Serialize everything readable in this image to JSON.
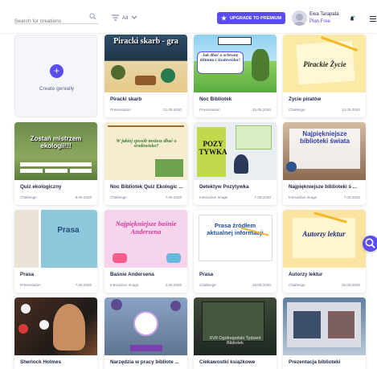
{
  "header": {
    "search_placeholder": "Search for creations",
    "filter_label": "All",
    "upgrade_label": "UPGRADE TO PREMIUM",
    "user_name": "Ewa Tarapata",
    "plan": "Plan Free"
  },
  "create": {
    "label": "Create genially"
  },
  "cards": [
    {
      "title": "Piracki skarb",
      "type": "Presentation",
      "date": "21.09.2020",
      "thumb_text": "Piracki skarb - gra"
    },
    {
      "title": "Noc Bibliotek",
      "type": "Presentation",
      "date": "15.09.2020",
      "thumb_text": "Jak dbać o ochronę klimatu i środowiska?"
    },
    {
      "title": "Życie piratów",
      "type": "Challenge",
      "date": "14.09.2020",
      "thumb_text": "Pirackie Życie"
    },
    {
      "title": "Quiz ekologiczny",
      "type": "Challenge",
      "date": "8.09.2020",
      "thumb_text": "Zostań mistrzem ekologii!!!"
    },
    {
      "title": "Noc Bibliotek Quiz Ekologic ...",
      "type": "Challenge",
      "date": "7.09.2020",
      "thumb_text": "W jakiej sposób możesz dbać o środowisko?"
    },
    {
      "title": "Detektyw Pozytywka",
      "type": "Interactive Image",
      "date": "7.09.2020",
      "thumb_text": "POZY TYWKA"
    },
    {
      "title": "Najpiękniejsze biblioteki ś ...",
      "type": "Interactive Image",
      "date": "7.09.2020",
      "thumb_text": "Najpiękniejsze biblioteki świata"
    },
    {
      "title": "Prasa",
      "type": "Presentation",
      "date": "7.09.2020",
      "thumb_text": "Prasa"
    },
    {
      "title": "Baśnie Andersena",
      "type": "Interactive Image",
      "date": "2.09.2020",
      "thumb_text": "Najpiękniejsze baśnie Andersena"
    },
    {
      "title": "Prasa",
      "type": "Challenge",
      "date": "29.09.2020",
      "thumb_text": "Prasa źródłem aktualnej informacji"
    },
    {
      "title": "Autorzy lektur",
      "type": "Challenge",
      "date": "26.09.2020",
      "thumb_text": "Autorzy lektur"
    },
    {
      "title": "Sherlock Holmes",
      "type": "",
      "date": "",
      "thumb_text": ""
    },
    {
      "title": "Narzędzia w pracy bibliote ...",
      "type": "",
      "date": "",
      "thumb_text": ""
    },
    {
      "title": "Ciekawostki książkowe",
      "type": "",
      "date": "",
      "thumb_text": "XVII Ogólnopolski Tydzień Bibliotek"
    },
    {
      "title": "Prezentacja biblioteki",
      "type": "",
      "date": "",
      "thumb_text": ""
    }
  ]
}
